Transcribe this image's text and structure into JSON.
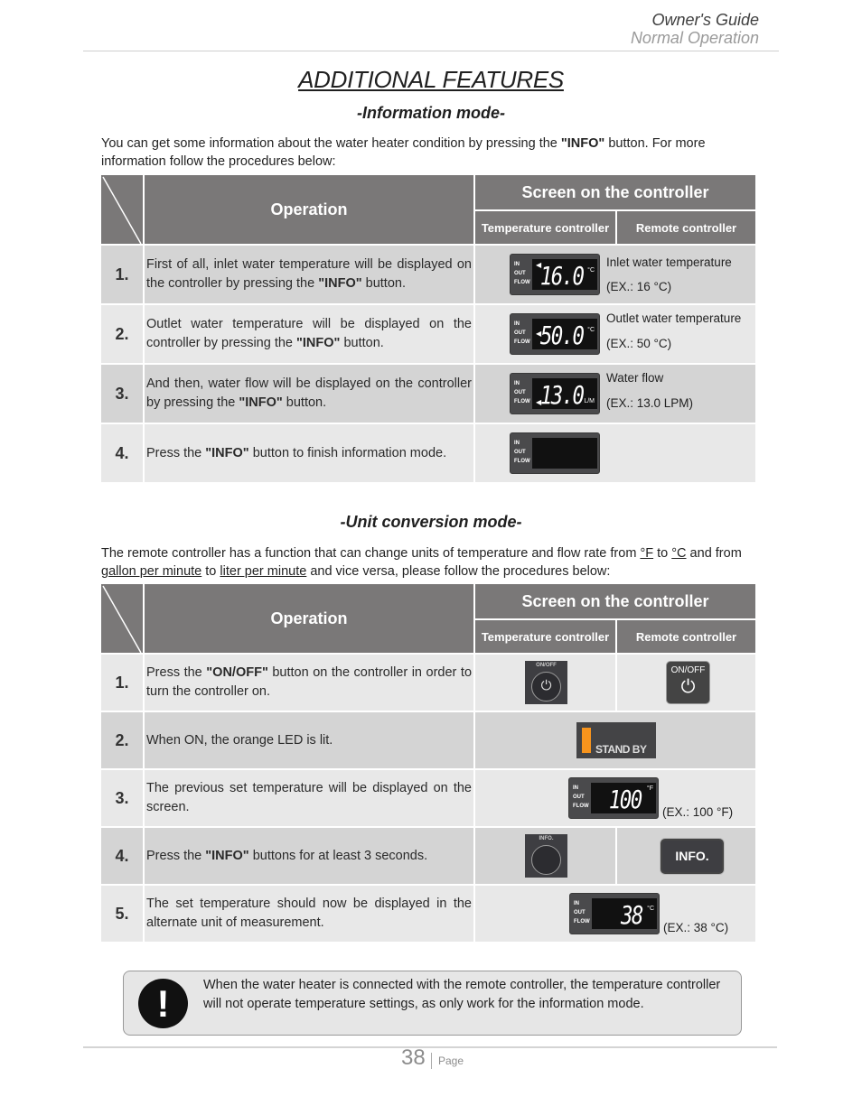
{
  "header": {
    "guide": "Owner's Guide",
    "section": "Normal Operation"
  },
  "title": "ADDITIONAL FEATURES",
  "info_mode": {
    "subtitle": "-Information mode-",
    "intro_pre": "You can get some information about the water heater condition by pressing the ",
    "intro_bold": "\"INFO\"",
    "intro_post": " button. For more information follow the procedures below:",
    "table": {
      "col_operation": "Operation",
      "col_screen": "Screen on the controller",
      "col_temp": "Temperature controller",
      "col_remote": "Remote controller",
      "rows": [
        {
          "num": "1.",
          "pre": "First of all, inlet water temperature will be displayed on the controller by pressing the ",
          "bold": "\"INFO\"",
          "post": " button.",
          "lcd": {
            "labels": [
              "IN",
              "OUT",
              "FLOW"
            ],
            "indicator": "IN",
            "value": "16.0",
            "unit": "°C"
          },
          "desc": "Inlet water temperature",
          "example": "(EX.: 16 °C)"
        },
        {
          "num": "2.",
          "pre": "Outlet water temperature will be displayed on the controller by pressing the ",
          "bold": "\"INFO\"",
          "post": " button.",
          "lcd": {
            "labels": [
              "IN",
              "OUT",
              "FLOW"
            ],
            "indicator": "OUT",
            "value": "50.0",
            "unit": "°C"
          },
          "desc": "Outlet water temperature",
          "example": "(EX.: 50 °C)"
        },
        {
          "num": "3.",
          "pre": "And then, water flow will be displayed on the controller by pressing the ",
          "bold": "\"INFO\"",
          "post": " button.",
          "lcd": {
            "labels": [
              "IN",
              "OUT",
              "FLOW"
            ],
            "indicator": "FLOW",
            "value": "13.0",
            "unit": "L/M"
          },
          "desc": "Water flow",
          "example": "(EX.: 13.0 LPM)"
        },
        {
          "num": "4.",
          "pre": "Press the ",
          "bold": "\"INFO\"",
          "post": " button to finish information mode.",
          "lcd": {
            "labels": [
              "IN",
              "OUT",
              "FLOW"
            ],
            "indicator": "",
            "value": "",
            "unit": ""
          }
        }
      ]
    }
  },
  "unit_mode": {
    "subtitle": "-Unit conversion mode-",
    "intro": {
      "a": "The remote controller has a function that can change units of temperature and flow rate from ",
      "u1": "°F",
      "b": " to ",
      "u2": "°C",
      "c": " and from ",
      "u3": "gallon per minute",
      "d": " to ",
      "u4": "liter per minute",
      "e": " and vice versa, please follow the procedures below:"
    },
    "table": {
      "col_operation": "Operation",
      "col_screen": "Screen on the controller",
      "col_temp": "Temperature controller",
      "col_remote": "Remote controller",
      "rows": [
        {
          "num": "1.",
          "pre": "Press the ",
          "bold": "\"ON/OFF\"",
          "post": " button on the controller in order to turn the controller on.",
          "temp_btn": "ON/OFF",
          "remote_btn": "ON/OFF"
        },
        {
          "num": "2.",
          "pre": "When ON, the orange LED is lit.",
          "bold": "",
          "post": "",
          "standby": "STAND BY",
          "led_color": "#f7941d"
        },
        {
          "num": "3.",
          "pre": "The previous set temperature will be displayed on the screen.",
          "bold": "",
          "post": "",
          "lcd": {
            "labels": [
              "IN",
              "OUT",
              "FLOW"
            ],
            "value": "100",
            "unit": "°F"
          },
          "example": "(EX.: 100 °F)"
        },
        {
          "num": "4.",
          "pre": "Press the ",
          "bold": "\"INFO\"",
          "post": " buttons for at least 3 seconds.",
          "temp_btn": "INFO.",
          "remote_btn": "INFO."
        },
        {
          "num": "5.",
          "pre": "The set temperature should now be displayed in the alternate unit of measurement.",
          "bold": "",
          "post": "",
          "lcd": {
            "labels": [
              "IN",
              "OUT",
              "FLOW"
            ],
            "value": "38",
            "unit": "°C"
          },
          "example": "(EX.: 38 °C)"
        }
      ]
    }
  },
  "warning": {
    "icon": "exclamation-icon",
    "text": "When the water heater is connected with the remote controller, the temperature controller will not operate temperature settings, as only work for the information mode."
  },
  "footer": {
    "page_number": "38",
    "page_label": "Page"
  }
}
